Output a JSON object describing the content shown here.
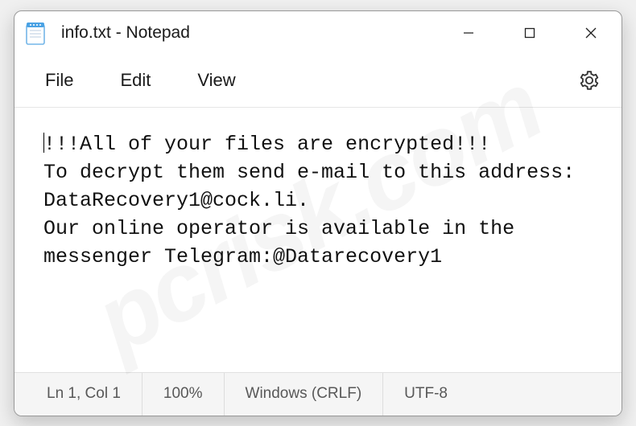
{
  "window": {
    "title": "info.txt - Notepad"
  },
  "menu": {
    "file": "File",
    "edit": "Edit",
    "view": "View"
  },
  "content": {
    "text": "!!!All of your files are encrypted!!!\nTo decrypt them send e-mail to this address: DataRecovery1@cock.li.\nOur online operator is available in the messenger Telegram:@Datarecovery1"
  },
  "status": {
    "position": "Ln 1, Col 1",
    "zoom": "100%",
    "lineending": "Windows (CRLF)",
    "encoding": "UTF-8"
  },
  "watermark": "pcrisk.com"
}
